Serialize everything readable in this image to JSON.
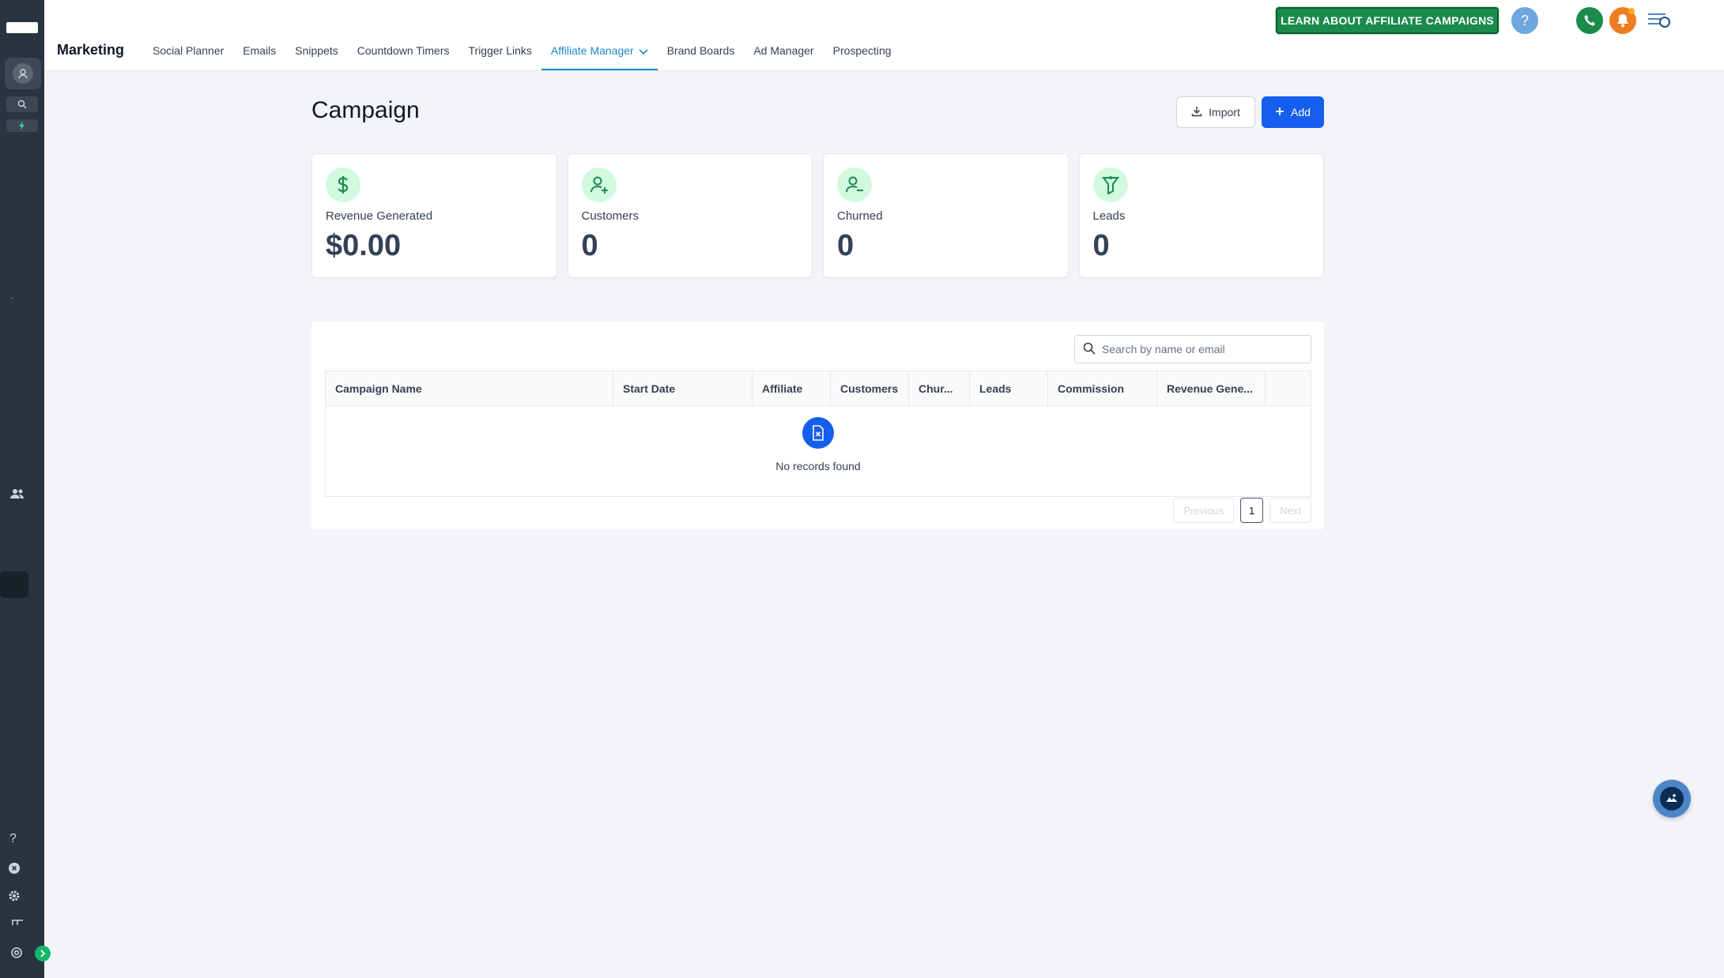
{
  "sidebar": {
    "logo_text": "",
    "help_glyph": "?",
    "icons": [
      "avatar-icon",
      "search-icon",
      "bolt-icon",
      "people-icon",
      "help-icon",
      "close-circle-icon",
      "gear-icon",
      "settings-icon",
      "expand-icon"
    ]
  },
  "header": {
    "section_title": "Marketing",
    "nav": [
      {
        "label": "Social Planner"
      },
      {
        "label": "Emails"
      },
      {
        "label": "Snippets"
      },
      {
        "label": "Countdown Timers"
      },
      {
        "label": "Trigger Links"
      },
      {
        "label": "Affiliate Manager",
        "active": true
      },
      {
        "label": "Brand Boards"
      },
      {
        "label": "Ad Manager"
      },
      {
        "label": "Prospecting"
      }
    ],
    "learn_button": "LEARN ABOUT AFFILIATE CAMPAIGNS",
    "help_glyph": "?",
    "colors": {
      "learn_bg": "#1b8a4b",
      "help_bg": "#6ea6df",
      "phone_bg": "#1b8a4b",
      "bell_bg": "#f07c22",
      "active_tab": "#1e88c7"
    }
  },
  "page": {
    "title": "Campaign",
    "import_label": "Import",
    "add_label": "Add",
    "add_color": "#155eef"
  },
  "stats": [
    {
      "label": "Revenue Generated",
      "value": "$0.00",
      "icon": "dollar-icon"
    },
    {
      "label": "Customers",
      "value": "0",
      "icon": "user-plus-icon"
    },
    {
      "label": "Churned",
      "value": "0",
      "icon": "user-minus-icon"
    },
    {
      "label": "Leads",
      "value": "0",
      "icon": "funnel-icon"
    }
  ],
  "table": {
    "search_placeholder": "Search by name or email",
    "columns": [
      "Campaign Name",
      "Start Date",
      "Affiliate",
      "Customers",
      "Chur...",
      "Leads",
      "Commission",
      "Revenue Gene...",
      ""
    ],
    "empty_text": "No records found",
    "pagination": {
      "previous": "Previous",
      "current_page": "1",
      "next": "Next"
    }
  }
}
